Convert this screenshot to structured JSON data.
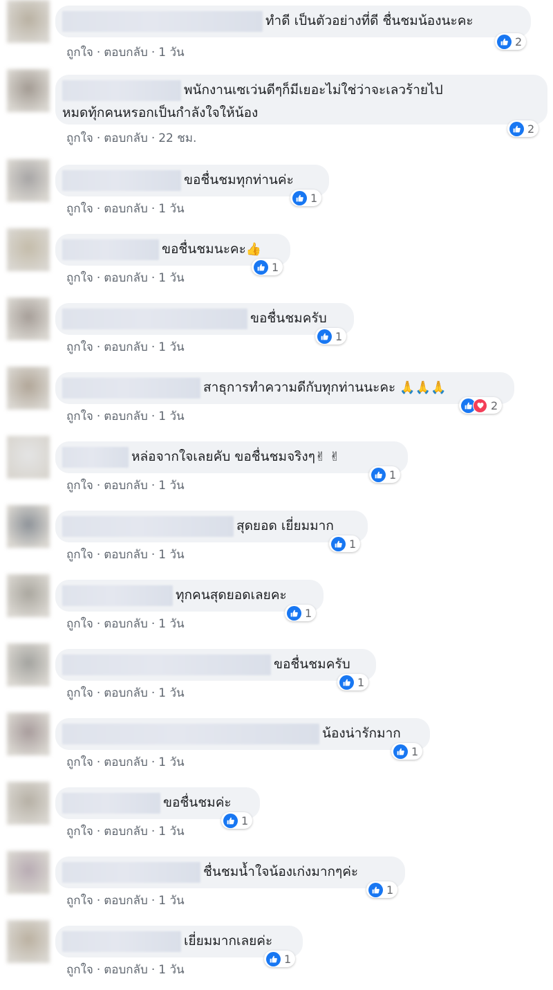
{
  "actions": {
    "like": "ถูกใจ",
    "reply": "ตอบกลับ",
    "separator": "·"
  },
  "colors": {
    "avatars": [
      "#b9b1a2",
      "#a39b93",
      "#a7a5a5",
      "#c4bcaa",
      "#a69e98",
      "#b1a698",
      "#e4e4e4",
      "#8e9399",
      "#aaa79f",
      "#a3a39f",
      "#a89c9c",
      "#b6b0a5",
      "#b8abb3",
      "#bbb1a1"
    ]
  },
  "comments": [
    {
      "text": "ทำดี เป็นตัวอย่างที่ดี ชื่นชมน้องนะคะ",
      "emoji": "",
      "time": "1 วัน",
      "reactions": [
        "like"
      ],
      "count": "2"
    },
    {
      "text": "พนักงานเซเว่นดีๆก็มีเยอะไม่ใช่ว่าจะเลวร้ายไป\nหมดทุ้กคนหรอกเป็นกำลังใจให้น้อง",
      "emoji": "",
      "time": "22 ชม.",
      "reactions": [
        "like"
      ],
      "count": "2"
    },
    {
      "text": "ขอชื่นชมทุกท่านค่ะ",
      "emoji": "",
      "time": "1 วัน",
      "reactions": [
        "like"
      ],
      "count": "1"
    },
    {
      "text": "ขอชื่นชมนะคะ",
      "emoji": "👍",
      "time": "1 วัน",
      "reactions": [
        "like"
      ],
      "count": "1"
    },
    {
      "text": "ขอชื่นชมครับ",
      "emoji": "",
      "time": "1 วัน",
      "reactions": [
        "like"
      ],
      "count": "1"
    },
    {
      "text": "สาธุการทำความดีกับทุกท่านนะคะ ",
      "emoji": "🙏🙏🙏",
      "time": "1 วัน",
      "reactions": [
        "like",
        "love"
      ],
      "count": "2"
    },
    {
      "text": "หล่อจากใจเลยคับ ขอชื่นชมจริงๆ",
      "emoji": "✌ ✌",
      "time": "1 วัน",
      "reactions": [
        "like"
      ],
      "count": "1"
    },
    {
      "text": "สุดยอด เยี่ยมมาก",
      "emoji": "",
      "time": "1 วัน",
      "reactions": [
        "like"
      ],
      "count": "1"
    },
    {
      "text": "ทุกคนสุดยอดเลยคะ",
      "emoji": "",
      "time": "1 วัน",
      "reactions": [
        "like"
      ],
      "count": "1"
    },
    {
      "text": "ขอชื่นชมครับ",
      "emoji": "",
      "time": "1 วัน",
      "reactions": [
        "like"
      ],
      "count": "1"
    },
    {
      "text": "น้องน่ารักมาก",
      "emoji": "",
      "time": "1 วัน",
      "reactions": [
        "like"
      ],
      "count": "1"
    },
    {
      "text": "ขอชื่นชมค่ะ",
      "emoji": "",
      "time": "1 วัน",
      "reactions": [
        "like"
      ],
      "count": "1"
    },
    {
      "text": "ชื่นชมน้ำใจน้องเก่งมากๆค่ะ",
      "emoji": "",
      "time": "1 วัน",
      "reactions": [
        "like"
      ],
      "count": "1"
    },
    {
      "text": "เยี่ยมมากเลยค่ะ",
      "emoji": "",
      "time": "1 วัน",
      "reactions": [
        "like"
      ],
      "count": "1"
    }
  ]
}
